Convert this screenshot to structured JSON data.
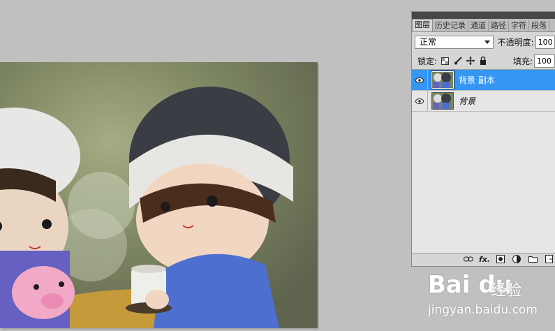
{
  "panel": {
    "tabs": [
      "图层",
      "历史记录",
      "通道",
      "路径",
      "字符",
      "段落"
    ],
    "blend_mode": "正常",
    "opacity_label": "不透明度:",
    "opacity_value": "100",
    "lock_label": "锁定:",
    "fill_label": "填充:",
    "fill_value": "100",
    "layers": [
      {
        "name": "背景 副本",
        "selected": true
      },
      {
        "name": "背景",
        "selected": false
      }
    ],
    "bottom_icons": [
      "link-icon",
      "fx-icon",
      "mask-icon",
      "adjustment-icon",
      "folder-icon",
      "new-layer-icon"
    ]
  },
  "watermark": {
    "logo": "Bai du",
    "cn": "经验",
    "url": "jingyan.baidu.com"
  },
  "colors": {
    "selected_layer": "#3596f4",
    "workspace": "#c0c0c0"
  }
}
